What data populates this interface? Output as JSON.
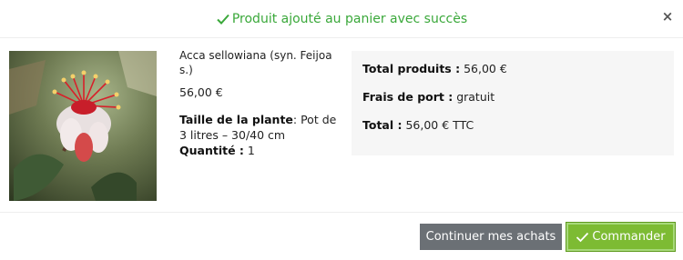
{
  "header": {
    "message": "Produit ajouté au panier avec succès",
    "close_symbol": "×",
    "success_color": "#3aa83a"
  },
  "product": {
    "name": "Acca sellowiana (syn. Feijoa s.)",
    "price": "56,00 €",
    "attribute_label": "Taille de la plante",
    "attribute_value": ": Pot de 3 litres – 30/40 cm",
    "quantity_label": "Quantité :",
    "quantity_value": " 1",
    "image_icon": "flower-photo"
  },
  "totals": {
    "products_label": "Total produits :",
    "products_value": " 56,00 €",
    "shipping_label": "Frais de port :",
    "shipping_value": " gratuit",
    "total_label": "Total :",
    "total_value": " 56,00 € TTC"
  },
  "buttons": {
    "continue_label": "Continuer mes achats",
    "order_label": "Commander",
    "continue_color": "#6b7075",
    "order_color": "#7dbb33"
  }
}
